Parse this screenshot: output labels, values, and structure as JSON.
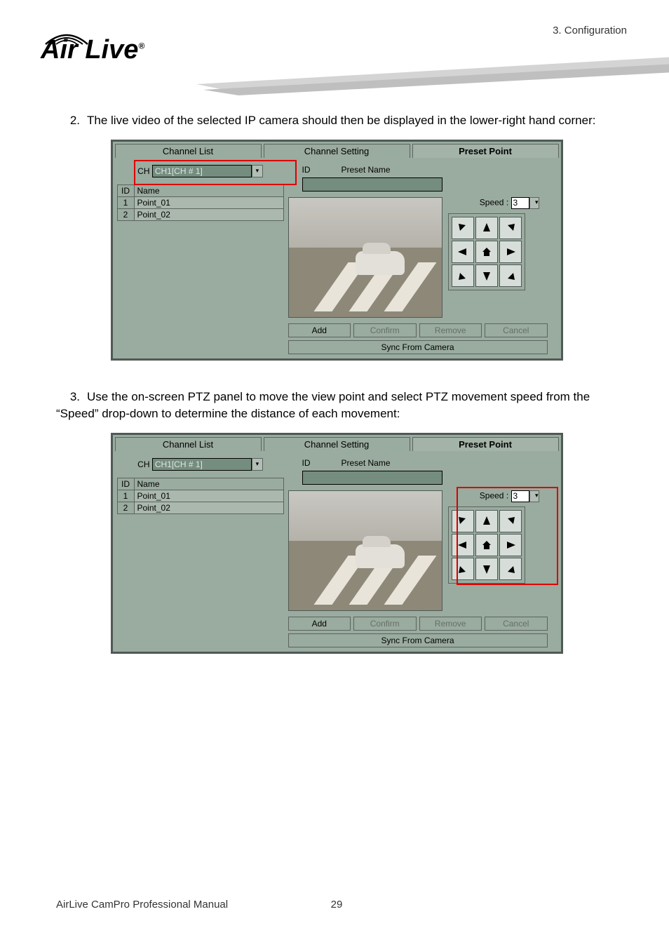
{
  "header": {
    "section": "3.  Configuration",
    "brand": "Air Live"
  },
  "steps": {
    "s2": {
      "num": "2.",
      "text": "The live video of the selected IP camera should then be displayed in the lower-right hand corner:"
    },
    "s3": {
      "num": "3.",
      "text": "Use the on-screen PTZ panel to move the view point and select PTZ movement speed from the “Speed” drop-down to determine the distance of each movement:"
    }
  },
  "app": {
    "tabs": {
      "channel_list": "Channel List",
      "channel_setting": "Channel Setting",
      "preset_point": "Preset Point"
    },
    "ch_label": "CH",
    "ch_selected": "CH1[CH # 1]",
    "table": {
      "id_hdr": "ID",
      "name_hdr": "Name",
      "rows": [
        {
          "id": "1",
          "name": "Point_01"
        },
        {
          "id": "2",
          "name": "Point_02"
        }
      ]
    },
    "preset": {
      "id_label": "ID",
      "name_label": "Preset Name"
    },
    "speed": {
      "label": "Speed :",
      "value": "3"
    },
    "buttons": {
      "add": "Add",
      "confirm": "Confirm",
      "remove": "Remove",
      "cancel": "Cancel",
      "sync": "Sync From Camera"
    }
  },
  "footer": {
    "doc_title": "AirLive  CamPro  Professional  Manual",
    "page": "29"
  }
}
